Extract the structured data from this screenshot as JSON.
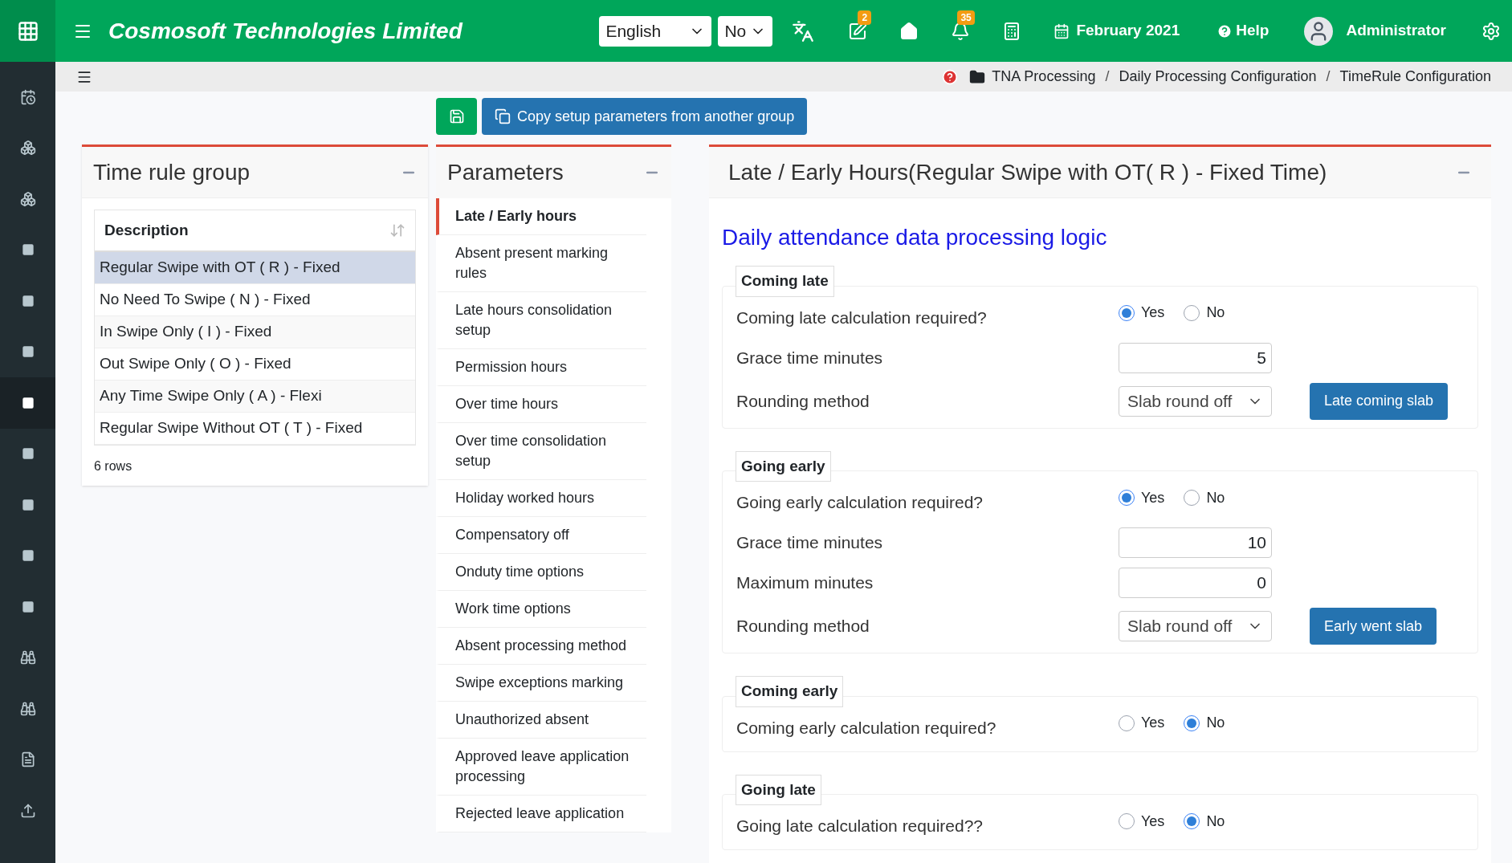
{
  "topbar": {
    "company": "Cosmosoft Technologies Limited",
    "language": "English",
    "option": "No",
    "edit_count": "2",
    "notification_count": "35",
    "period": "February 2021",
    "help": "Help",
    "user": "Administrator"
  },
  "sidebar": {
    "items": [
      {
        "selected": false
      },
      {
        "selected": false
      },
      {
        "selected": false
      },
      {
        "selected": false
      },
      {
        "selected": false
      },
      {
        "selected": false
      },
      {
        "selected": true
      },
      {
        "selected": false
      },
      {
        "selected": false
      },
      {
        "selected": false
      },
      {
        "selected": false
      },
      {
        "selected": false
      },
      {
        "selected": false
      },
      {
        "selected": false
      },
      {
        "selected": false
      }
    ]
  },
  "breadcrumb": {
    "items": [
      "TNA Processing",
      "Daily Processing Configuration",
      "TimeRule Configuration"
    ],
    "separator": "/"
  },
  "toolbar": {
    "copy_button": "Copy setup parameters from another group"
  },
  "group_panel": {
    "title": "Time rule group",
    "column": "Description",
    "rows": [
      {
        "text": "Regular Swipe with OT ( R ) - Fixed",
        "selected": true
      },
      {
        "text": "No Need To Swipe ( N ) - Fixed",
        "selected": false
      },
      {
        "text": "In Swipe Only ( I ) - Fixed",
        "selected": false
      },
      {
        "text": "Out Swipe Only ( O ) - Fixed",
        "selected": false
      },
      {
        "text": "Any Time Swipe Only ( A ) - Flexi",
        "selected": false
      },
      {
        "text": "Regular Swipe Without OT ( T ) - Fixed",
        "selected": false
      }
    ],
    "footer": "6 rows"
  },
  "parameters_panel": {
    "title": "Parameters",
    "items": [
      {
        "text": "Late / Early hours",
        "selected": true
      },
      {
        "text": "Absent present marking rules",
        "selected": false
      },
      {
        "text": "Late hours consolidation setup",
        "selected": false
      },
      {
        "text": "Permission hours",
        "selected": false
      },
      {
        "text": "Over time hours",
        "selected": false
      },
      {
        "text": "Over time consolidation setup",
        "selected": false
      },
      {
        "text": "Holiday worked hours",
        "selected": false
      },
      {
        "text": "Compensatory off",
        "selected": false
      },
      {
        "text": "Onduty time options",
        "selected": false
      },
      {
        "text": "Work time options",
        "selected": false
      },
      {
        "text": "Absent processing method",
        "selected": false
      },
      {
        "text": "Swipe exceptions marking",
        "selected": false
      },
      {
        "text": "Unauthorized absent",
        "selected": false
      },
      {
        "text": "Approved leave application processing",
        "selected": false
      },
      {
        "text": "Rejected leave application",
        "selected": false
      }
    ]
  },
  "detail_panel": {
    "title": "Late / Early Hours(Regular Swipe with OT( R ) - Fixed Time)",
    "heading": "Daily attendance data processing logic",
    "sections": [
      {
        "legend": "Coming late",
        "rows": [
          {
            "kind": "radio",
            "label": "Coming late calculation required?",
            "options": [
              {
                "label": "Yes",
                "selected": true
              },
              {
                "label": "No",
                "selected": false
              }
            ]
          },
          {
            "kind": "number",
            "label": "Grace time minutes",
            "value": "5"
          },
          {
            "kind": "select",
            "label": "Rounding method",
            "value": "Slab round off",
            "button": "Late coming slab"
          }
        ]
      },
      {
        "legend": "Going early",
        "rows": [
          {
            "kind": "radio",
            "label": "Going early calculation required?",
            "options": [
              {
                "label": "Yes",
                "selected": true
              },
              {
                "label": "No",
                "selected": false
              }
            ]
          },
          {
            "kind": "number",
            "label": "Grace time minutes",
            "value": "10"
          },
          {
            "kind": "number",
            "label": "Maximum minutes",
            "value": "0"
          },
          {
            "kind": "select",
            "label": "Rounding method",
            "value": "Slab round off",
            "button": "Early went slab"
          }
        ]
      },
      {
        "legend": "Coming early",
        "rows": [
          {
            "kind": "radio",
            "label": "Coming early calculation required?",
            "options": [
              {
                "label": "Yes",
                "selected": false
              },
              {
                "label": "No",
                "selected": true
              }
            ]
          }
        ]
      },
      {
        "legend": "Going late",
        "rows": [
          {
            "kind": "radio",
            "label": "Going late calculation required??",
            "options": [
              {
                "label": "Yes",
                "selected": false
              },
              {
                "label": "No",
                "selected": true
              }
            ]
          }
        ]
      }
    ]
  }
}
